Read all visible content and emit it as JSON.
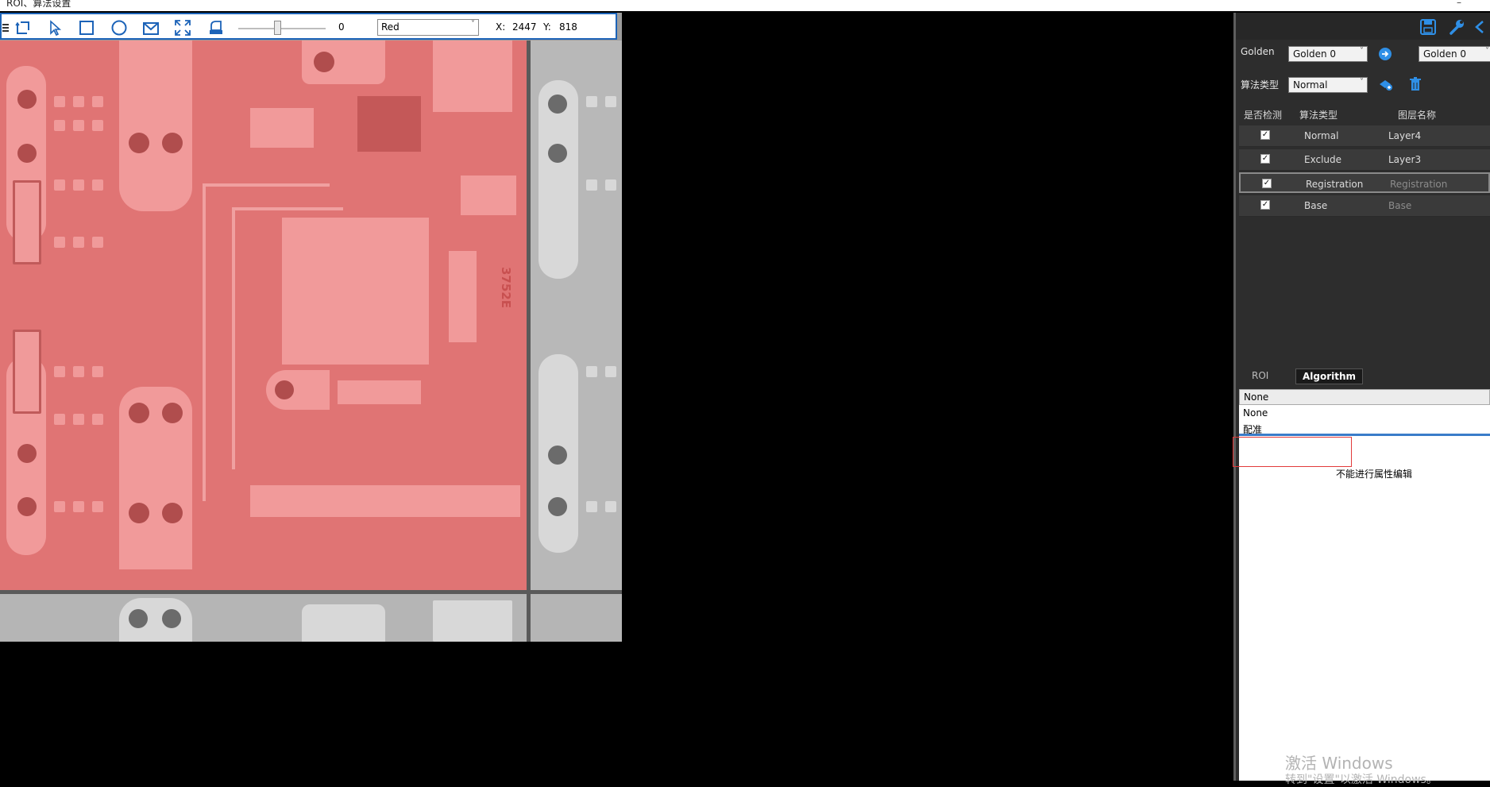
{
  "window": {
    "title": "ROI、算法设置"
  },
  "toolbar": {
    "slider_value": "0",
    "color_value": "Red",
    "x_label": "X:",
    "x_value": "2447",
    "y_label": "Y:",
    "y_value": "818",
    "slider_level": 0.45,
    "icons": [
      "menu-icon",
      "roi-transform-icon",
      "pointer-icon",
      "rectangle-icon",
      "circle-icon",
      "polygon-icon",
      "fit-screen-icon",
      "eraser-icon"
    ]
  },
  "viewer": {
    "chip_text": "3752E"
  },
  "panel": {
    "golden_label": "Golden",
    "golden_left": "Golden 0",
    "golden_right": "Golden 0",
    "algo_label": "算法类型",
    "algo_value": "Normal",
    "headers": {
      "check": "是否检测",
      "algo": "算法类型",
      "layer": "图层名称"
    },
    "layers": [
      {
        "checked": true,
        "algo": "Normal",
        "layer": "Layer4"
      },
      {
        "checked": true,
        "algo": "Exclude",
        "layer": "Layer3"
      },
      {
        "checked": true,
        "algo": "Registration",
        "layer": "Registration"
      },
      {
        "checked": true,
        "algo": "Base",
        "layer": "Base"
      }
    ],
    "tabs": {
      "roi": "ROI",
      "algorithm": "Algorithm"
    },
    "property": {
      "selected": "None",
      "options": [
        "None",
        "配准"
      ],
      "message": "不能进行属性编辑"
    },
    "watermark": {
      "line1": "激活 Windows",
      "line2": "转到\"设置\"以激活 Windows。"
    }
  },
  "colors": {
    "accent": "#1c63b8",
    "mask": "#e07474",
    "panel_bg": "#2d2d2d",
    "highlight": "#e23a3a"
  }
}
